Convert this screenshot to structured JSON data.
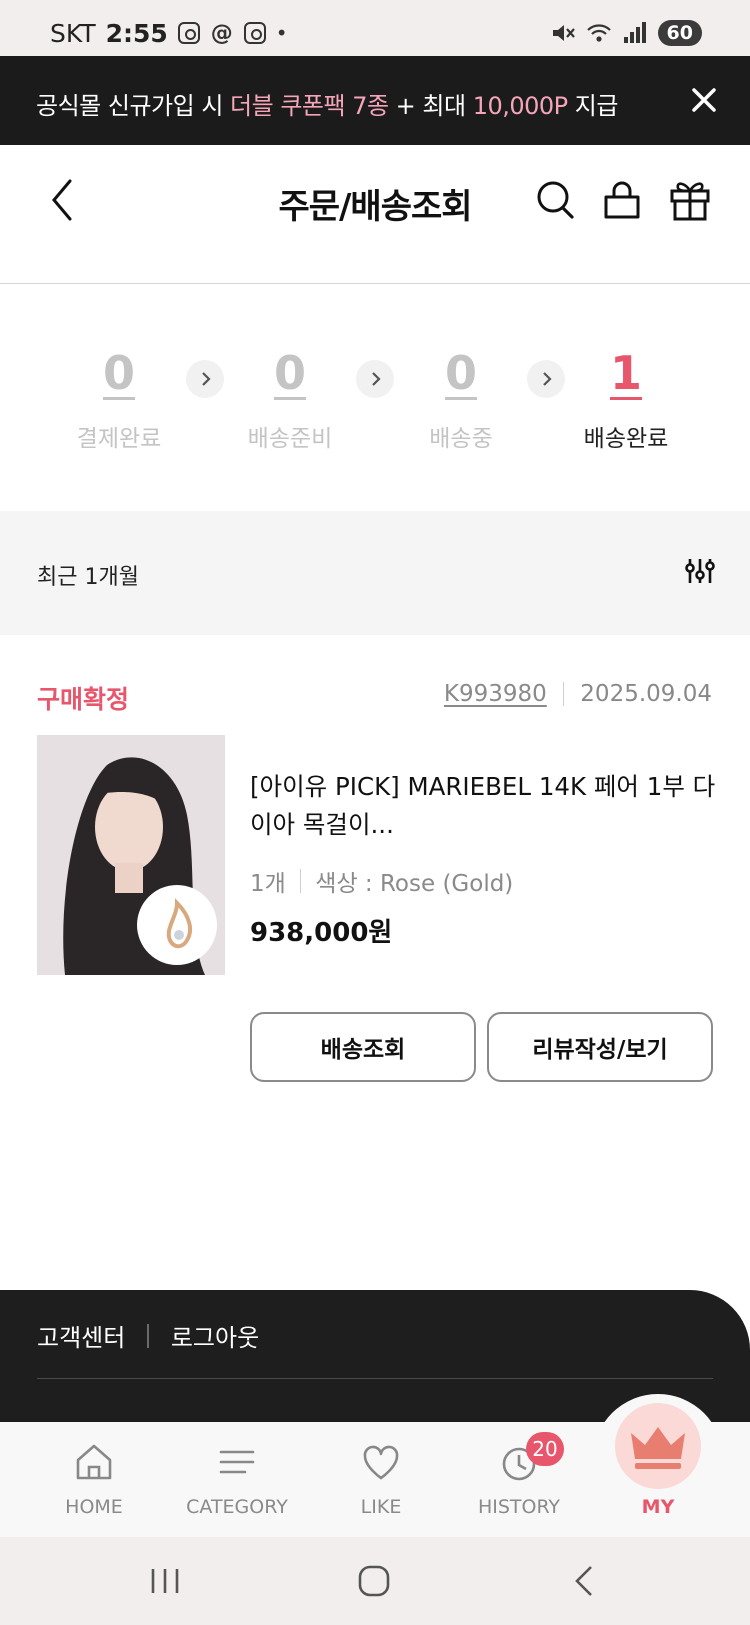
{
  "status_bar": {
    "carrier": "SKT",
    "time": "2:55",
    "battery": "60",
    "app_icons": [
      "instagram-icon",
      "threads-icon",
      "instagram-icon"
    ],
    "indicator": "•"
  },
  "promo": {
    "text_1": "공식몰 신규가입 시 ",
    "highlight_1": "더블 쿠폰팩 7종",
    "text_2": " + 최대 ",
    "highlight_2": "10,000P",
    "text_3": " 지급"
  },
  "header": {
    "title": "주문/배송조회"
  },
  "steps": [
    {
      "count": "0",
      "label": "결제완료",
      "active": false
    },
    {
      "count": "0",
      "label": "배송준비",
      "active": false
    },
    {
      "count": "0",
      "label": "배송중",
      "active": false
    },
    {
      "count": "1",
      "label": "배송완료",
      "active": true
    }
  ],
  "filter": {
    "period": "최근 1개월"
  },
  "order": {
    "status": "구매확정",
    "order_no": "K993980",
    "date": "2025.09.04",
    "product_name": "[아이유 PICK] MARIEBEL 14K 페어 1부 다이아 목걸이...",
    "quantity": "1개",
    "option": "색상 : Rose (Gold)",
    "price": "938,000원",
    "track_button": "배송조회",
    "review_button": "리뷰작성/보기"
  },
  "footer": {
    "support": "고객센터",
    "logout": "로그아웃"
  },
  "bottom_nav": {
    "items": [
      {
        "label": "HOME",
        "icon": "home-icon"
      },
      {
        "label": "CATEGORY",
        "icon": "menu-icon"
      },
      {
        "label": "LIKE",
        "icon": "heart-icon"
      },
      {
        "label": "HISTORY",
        "icon": "history-icon"
      },
      {
        "label": "MY",
        "icon": "crown-icon"
      }
    ],
    "history_badge": "20"
  },
  "colors": {
    "accent": "#e8566c",
    "banner_bg": "#1b1b1b",
    "banner_highlight": "#f4a6b8",
    "muted": "#c4c4c4"
  }
}
